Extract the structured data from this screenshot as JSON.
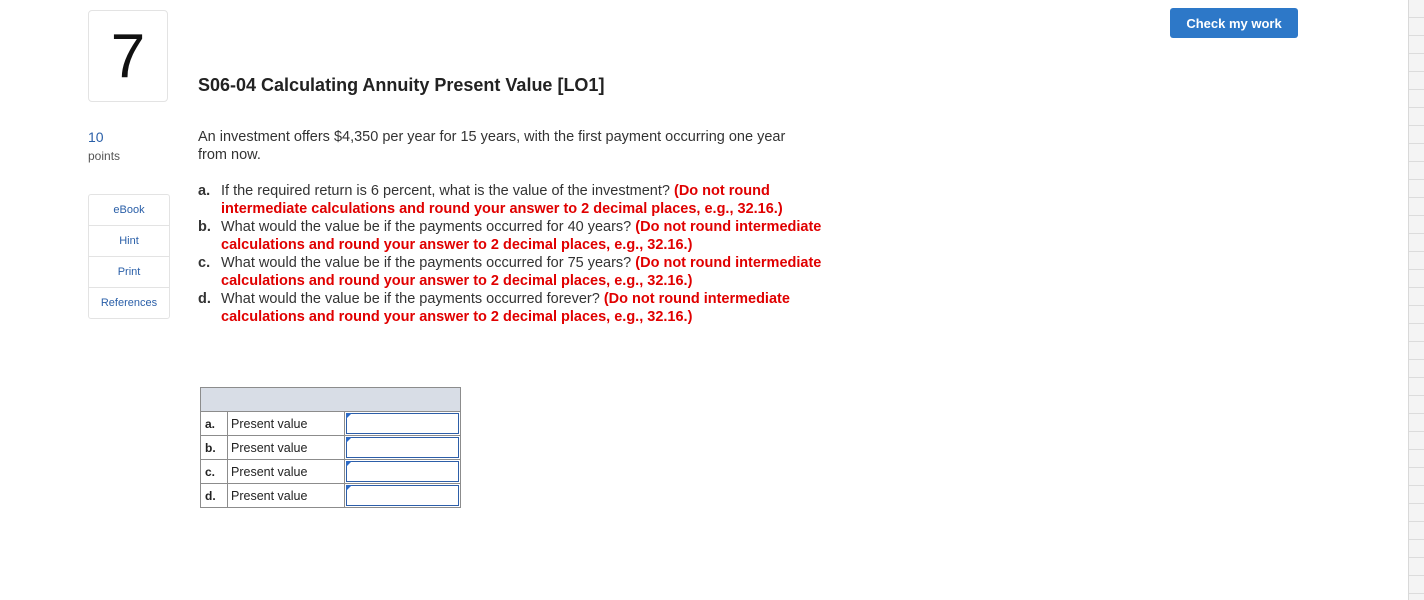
{
  "question": {
    "number": "7",
    "title": "S06-04 Calculating Annuity Present Value [LO1]",
    "points_value": "10",
    "points_label": "points",
    "intro": "An investment offers $4,350 per year for 15 years, with the first payment occurring one year from now.",
    "parts": [
      {
        "letter": "a.",
        "text": "If the required return is 6 percent, what is the value of the investment?",
        "note": "(Do not round intermediate calculations and round your answer to 2 decimal places, e.g., 32.16.)"
      },
      {
        "letter": "b.",
        "text": "What would the value be if the payments occurred for 40 years?",
        "note": "(Do not round intermediate calculations and round your answer to 2 decimal places, e.g., 32.16.)"
      },
      {
        "letter": "c.",
        "text": "What would the value be if the payments occurred for 75 years?",
        "note": "(Do not round intermediate calculations and round your answer to 2 decimal places, e.g., 32.16.)"
      },
      {
        "letter": "d.",
        "text": "What would the value be if the payments occurred forever?",
        "note": "(Do not round intermediate calculations and round your answer to 2 decimal places, e.g., 32.16.)"
      }
    ]
  },
  "sidebar": {
    "items": [
      {
        "label": "eBook"
      },
      {
        "label": "Hint"
      },
      {
        "label": "Print"
      },
      {
        "label": "References"
      }
    ]
  },
  "toolbar": {
    "check_label": "Check my work",
    "accent_color": "#2d78c8"
  },
  "answer_table": {
    "rows": [
      {
        "letter": "a.",
        "label": "Present value",
        "value": ""
      },
      {
        "letter": "b.",
        "label": "Present value",
        "value": ""
      },
      {
        "letter": "c.",
        "label": "Present value",
        "value": ""
      },
      {
        "letter": "d.",
        "label": "Present value",
        "value": ""
      }
    ]
  }
}
